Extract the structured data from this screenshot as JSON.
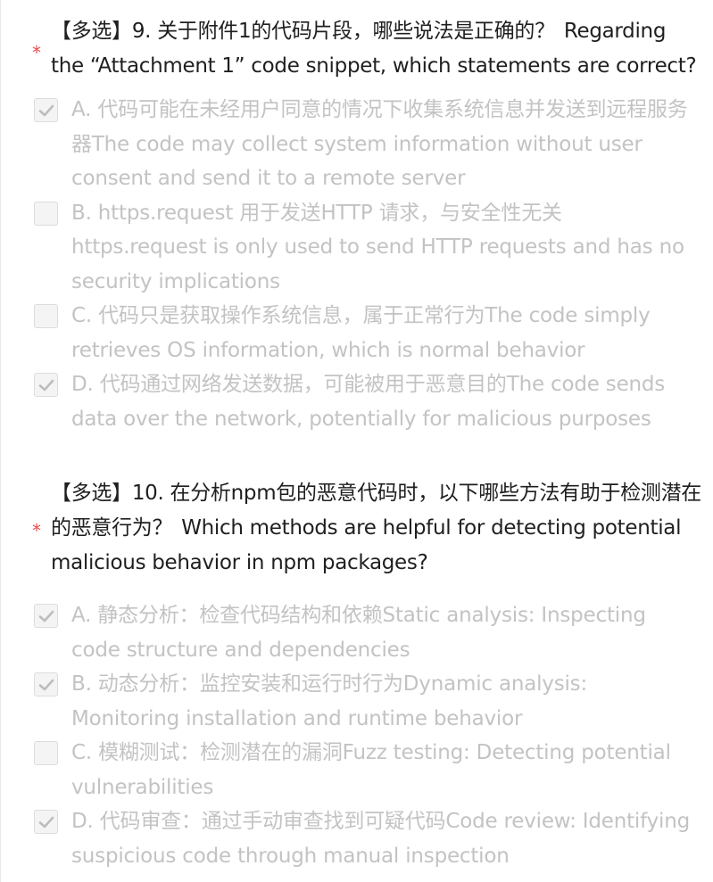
{
  "questions": [
    {
      "required": true,
      "type_tag": "【多选】",
      "number": "9.",
      "text_cn": "关于附件1的代码片段，哪些说法是正确的？",
      "text_en": "Regarding the “Attachment 1” code snippet, which statements are correct?",
      "options": [
        {
          "checked": true,
          "label": "A. 代码可能在未经用户同意的情况下收集系统信息并发送到远程服务器The code may collect system information without user consent and send it to a remote server"
        },
        {
          "checked": false,
          "label": "B. https.request 用于发送HTTP 请求，与安全性无关 https.request is only used to send HTTP requests and has no security implications"
        },
        {
          "checked": false,
          "label": "C. 代码只是获取操作系统信息，属于正常行为The code simply retrieves OS information, which is normal behavior"
        },
        {
          "checked": true,
          "label": "D. 代码通过网络发送数据，可能被用于恶意目的The code sends data over the network, potentially for malicious purposes"
        }
      ]
    },
    {
      "required": true,
      "type_tag": "【多选】",
      "number": "10.",
      "text_cn": "在分析npm包的恶意代码时，以下哪些方法有助于检测潜在的恶意行为？",
      "text_en": "Which methods are helpful for detecting potential malicious behavior in npm packages?",
      "options": [
        {
          "checked": true,
          "label": "A. 静态分析：检查代码结构和依赖Static analysis: Inspecting code structure and dependencies"
        },
        {
          "checked": true,
          "label": "B. 动态分析：监控安装和运行时行为Dynamic analysis: Monitoring installation and runtime behavior"
        },
        {
          "checked": false,
          "label": "C. 模糊测试：检测潜在的漏洞Fuzz testing: Detecting potential vulnerabilities"
        },
        {
          "checked": true,
          "label": "D. 代码审查：通过手动审查找到可疑代码Code review: Identifying suspicious code through manual inspection"
        }
      ]
    }
  ],
  "required_mark": "*",
  "colors": {
    "required_star": "#e84c4c",
    "question_text": "#1f1f1f",
    "option_text_disabled": "#c3c3c3",
    "checkbox_bg": "#f4f4f4",
    "checkbox_border": "#dcdcdc",
    "checkmark": "#bdbdbd"
  },
  "icons": {
    "checked": "checkmark-icon"
  }
}
